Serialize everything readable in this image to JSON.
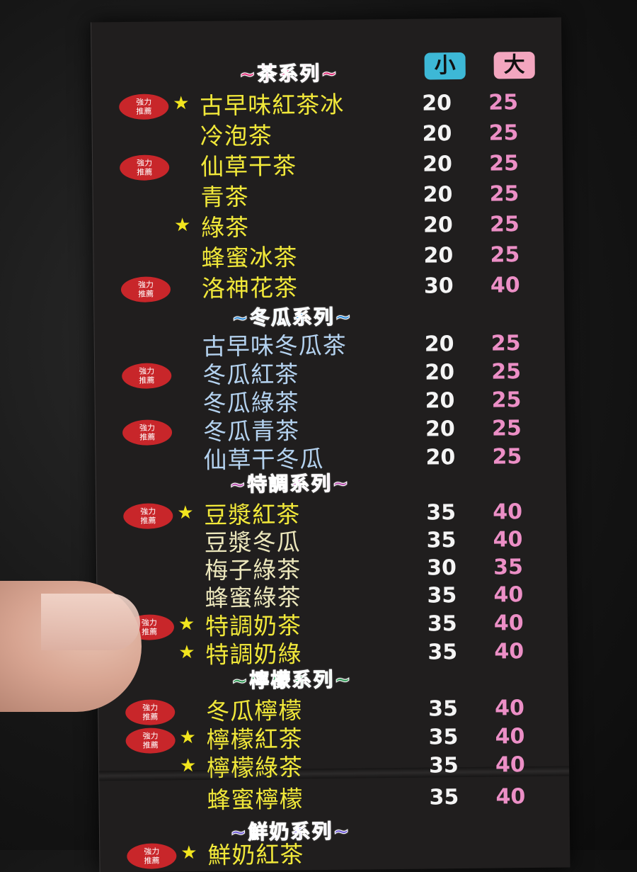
{
  "sizes": {
    "small": "小",
    "large": "大",
    "small_color": "#3db8d6",
    "large_color": "#f3a6bf"
  },
  "badge_text": [
    "強力",
    "推薦"
  ],
  "headers": {
    "tea": "~茶系列~",
    "melon": "~冬瓜系列~",
    "special": "~特調系列~",
    "lemon": "~檸檬系列~",
    "milk": "~鮮奶系列~"
  },
  "colors": {
    "tea_header": "#e0307a",
    "melon_header": "#2c8ad8",
    "special_header": "#b84fae",
    "lemon_header": "#2f9a56",
    "milk_header": "#6f5bd6",
    "badge": "#c8262a",
    "star": "#f2e51e",
    "large_price": "#ec8fc6"
  },
  "items": [
    {
      "name": "古早味紅茶冰",
      "small": "20",
      "large": "25",
      "badge": true,
      "star": true
    },
    {
      "name": "冷泡茶",
      "small": "20",
      "large": "25",
      "badge": false,
      "star": false
    },
    {
      "name": "仙草干茶",
      "small": "20",
      "large": "25",
      "badge": true,
      "star": false
    },
    {
      "name": "青茶",
      "small": "20",
      "large": "25",
      "badge": false,
      "star": false
    },
    {
      "name": "綠茶",
      "small": "20",
      "large": "25",
      "badge": false,
      "star": true
    },
    {
      "name": "蜂蜜冰茶",
      "small": "20",
      "large": "25",
      "badge": false,
      "star": false
    },
    {
      "name": "洛神花茶",
      "small": "30",
      "large": "40",
      "badge": true,
      "star": false
    },
    {
      "name": "古早味冬瓜茶",
      "small": "20",
      "large": "25",
      "badge": false,
      "star": false
    },
    {
      "name": "冬瓜紅茶",
      "small": "20",
      "large": "25",
      "badge": true,
      "star": false
    },
    {
      "name": "冬瓜綠茶",
      "small": "20",
      "large": "25",
      "badge": false,
      "star": false
    },
    {
      "name": "冬瓜青茶",
      "small": "20",
      "large": "25",
      "badge": true,
      "star": false
    },
    {
      "name": "仙草干冬瓜",
      "small": "20",
      "large": "25",
      "badge": false,
      "star": false
    },
    {
      "name": "豆漿紅茶",
      "small": "35",
      "large": "40",
      "badge": true,
      "star": true
    },
    {
      "name": "豆漿冬瓜",
      "small": "35",
      "large": "40",
      "badge": false,
      "star": false
    },
    {
      "name": "梅子綠茶",
      "small": "30",
      "large": "35",
      "badge": false,
      "star": false
    },
    {
      "name": "蜂蜜綠茶",
      "small": "35",
      "large": "40",
      "badge": false,
      "star": false
    },
    {
      "name": "特調奶茶",
      "small": "35",
      "large": "40",
      "badge": true,
      "star": true
    },
    {
      "name": "特調奶綠",
      "small": "35",
      "large": "40",
      "badge": false,
      "star": true
    },
    {
      "name": "冬瓜檸檬",
      "small": "35",
      "large": "40",
      "badge": true,
      "star": false
    },
    {
      "name": "檸檬紅茶",
      "small": "35",
      "large": "40",
      "badge": true,
      "star": true
    },
    {
      "name": "檸檬綠茶",
      "small": "35",
      "large": "40",
      "badge": false,
      "star": true
    },
    {
      "name": "蜂蜜檸檬",
      "small": "35",
      "large": "40",
      "badge": false,
      "star": false
    },
    {
      "name": "鮮奶紅茶",
      "small": "",
      "large": "",
      "badge": true,
      "star": true
    }
  ]
}
